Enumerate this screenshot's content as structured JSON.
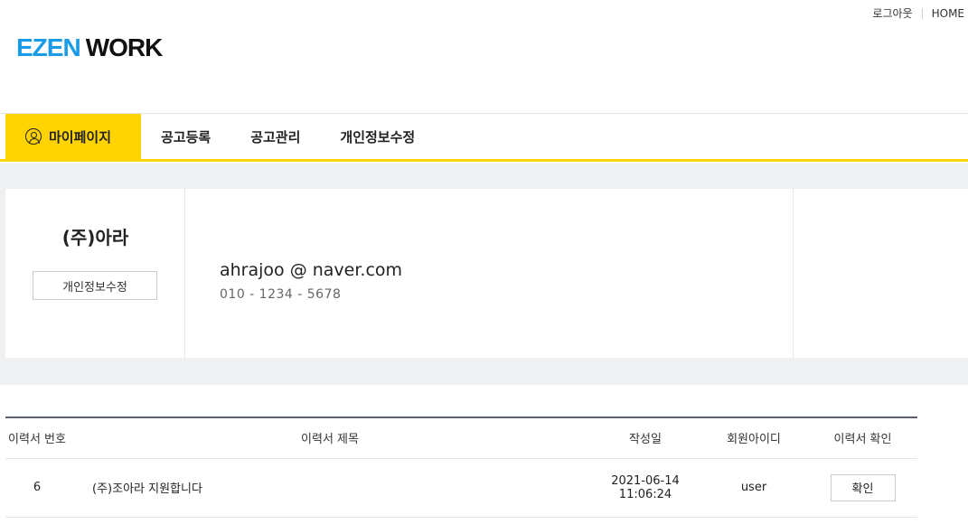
{
  "utility": {
    "logout": "로그아웃",
    "home": "HOME"
  },
  "logo": {
    "part1": "EZEN",
    "part2": "WORK"
  },
  "nav": {
    "mypage": "마이페이지",
    "post_job": "공고등록",
    "manage_jobs": "공고관리",
    "edit_profile": "개인정보수정"
  },
  "profile": {
    "company": "(주)아라",
    "edit_button": "개인정보수정",
    "email": "ahrajoo @ naver.com",
    "phone": "010 - 1234 - 5678"
  },
  "table": {
    "headers": {
      "number": "이력서 번호",
      "title": "이력서 제목",
      "date": "작성일",
      "member_id": "회원아이디",
      "check": "이력서 확인"
    },
    "rows": [
      {
        "number": "6",
        "title": "(주)조아라 지원합니다",
        "date": "2021-06-14",
        "time": "11:06:24",
        "member_id": "user",
        "action": "확인"
      }
    ]
  },
  "colors": {
    "accent": "#ffd400",
    "logo_blue": "#1a9be6",
    "band_bg": "#eef0f2",
    "table_border": "#5a5f75"
  }
}
